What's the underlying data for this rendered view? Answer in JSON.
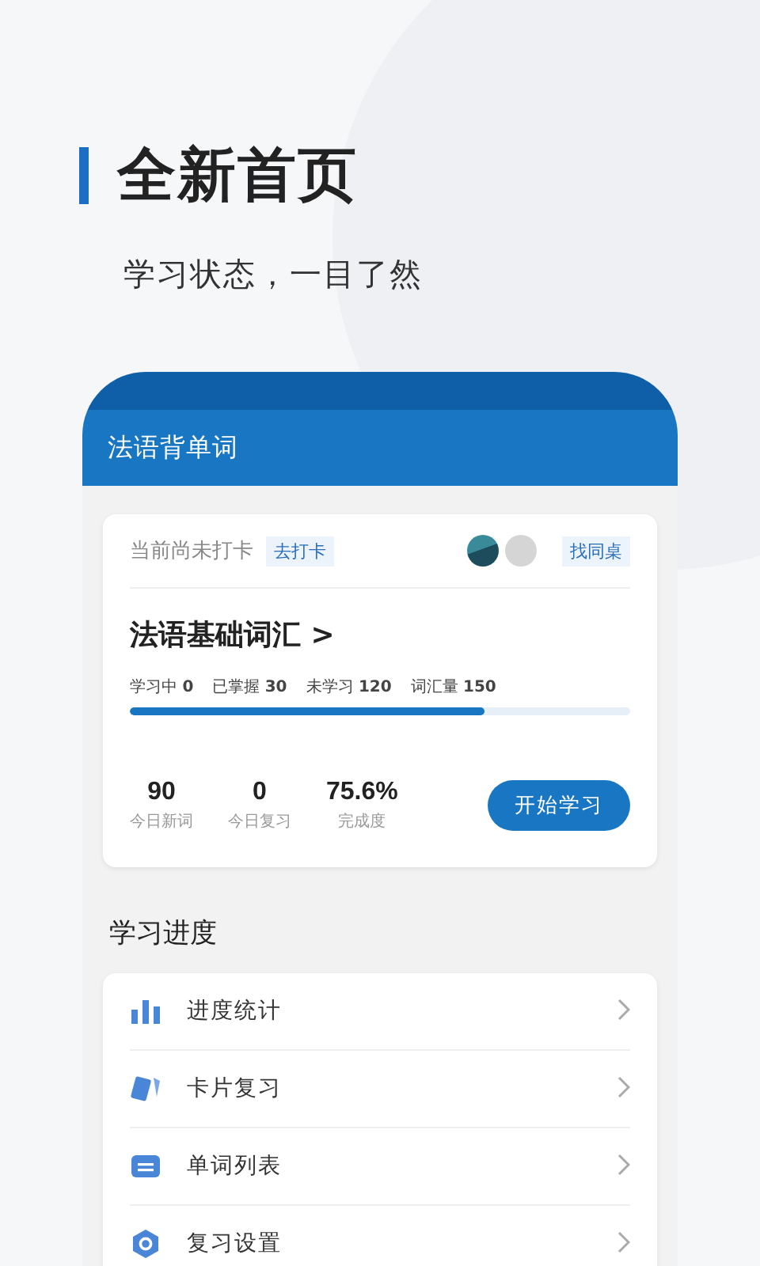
{
  "promo": {
    "title": "全新首页",
    "subtitle": "学习状态，一目了然"
  },
  "app": {
    "title": "法语背单词",
    "checkin": {
      "status": "当前尚未打卡",
      "action": "去打卡",
      "partner_action": "找同桌"
    },
    "book": {
      "title": "法语基础词汇",
      "chevron": ">",
      "counts": [
        {
          "label": "学习中",
          "value": "0"
        },
        {
          "label": "已掌握",
          "value": "30"
        },
        {
          "label": "未学习",
          "value": "120"
        },
        {
          "label": "词汇量",
          "value": "150"
        }
      ],
      "progress": {
        "level": 0.71
      }
    },
    "stats": [
      {
        "value": "90",
        "label": "今日新词"
      },
      {
        "value": "0",
        "label": "今日复习"
      },
      {
        "value": "75.6%",
        "label": "完成度"
      }
    ],
    "start_button": "开始学习",
    "section_title": "学习进度",
    "menu": [
      {
        "kind": "stats",
        "label": "进度统计"
      },
      {
        "kind": "cards",
        "label": "卡片复习"
      },
      {
        "kind": "list",
        "label": "单词列表"
      },
      {
        "kind": "settings",
        "label": "复习设置"
      }
    ]
  }
}
